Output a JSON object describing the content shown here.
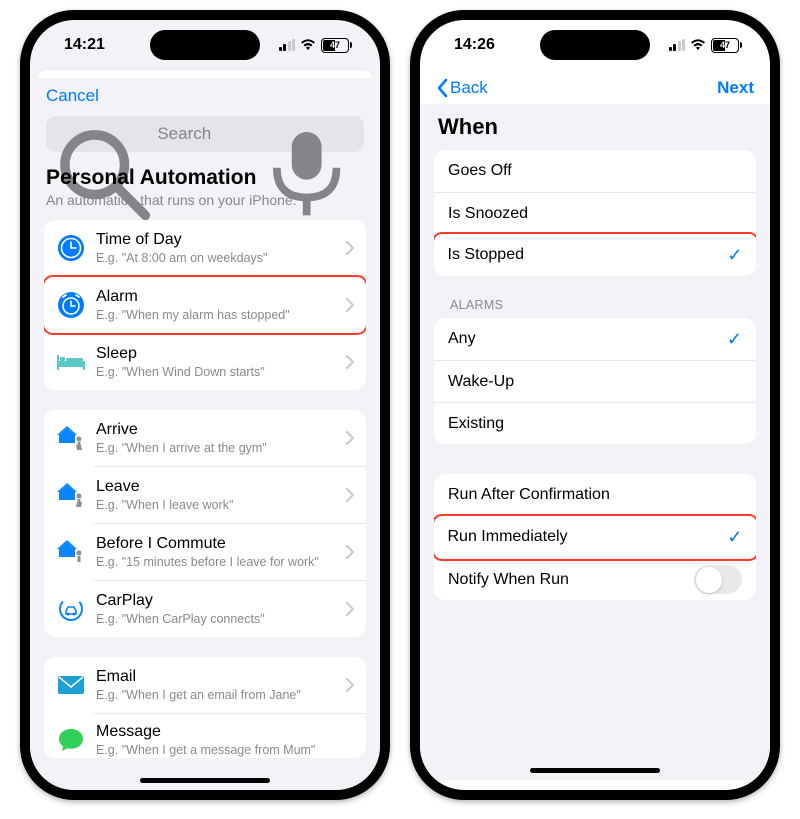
{
  "left": {
    "status": {
      "time": "14:21",
      "battery": "47"
    },
    "nav": {
      "cancel": "Cancel"
    },
    "search": {
      "placeholder": "Search"
    },
    "headline": {
      "title": "Personal Automation",
      "subtitle": "An automation that runs on your iPhone."
    },
    "groups": [
      {
        "rows": [
          {
            "icon": "clock-icon",
            "title": "Time of Day",
            "sub": "E.g. \"At 8:00 am on weekdays\"",
            "hl": false
          },
          {
            "icon": "alarm-icon",
            "title": "Alarm",
            "sub": "E.g. \"When my alarm has stopped\"",
            "hl": true
          },
          {
            "icon": "bed-icon",
            "title": "Sleep",
            "sub": "E.g. \"When Wind Down starts\"",
            "hl": false
          }
        ]
      },
      {
        "rows": [
          {
            "icon": "house-arrive-icon",
            "title": "Arrive",
            "sub": "E.g. \"When I arrive at the gym\"",
            "hl": false
          },
          {
            "icon": "house-leave-icon",
            "title": "Leave",
            "sub": "E.g. \"When I leave work\"",
            "hl": false
          },
          {
            "icon": "house-commute-icon",
            "title": "Before I Commute",
            "sub": "E.g. \"15 minutes before I leave for work\"",
            "hl": false
          },
          {
            "icon": "carplay-icon",
            "title": "CarPlay",
            "sub": "E.g. \"When CarPlay connects\"",
            "hl": false
          }
        ]
      },
      {
        "rows": [
          {
            "icon": "email-icon",
            "title": "Email",
            "sub": "E.g. \"When I get an email from Jane\"",
            "hl": false
          },
          {
            "icon": "message-icon",
            "title": "Message",
            "sub": "E.g. \"When I get a message from Mum\"",
            "hl": false
          }
        ]
      }
    ]
  },
  "right": {
    "status": {
      "time": "14:26",
      "battery": "47"
    },
    "nav": {
      "back": "Back",
      "next": "Next"
    },
    "title": "When",
    "when_group": [
      {
        "label": "Goes Off",
        "check": false,
        "hl": false
      },
      {
        "label": "Is Snoozed",
        "check": false,
        "hl": false
      },
      {
        "label": "Is Stopped",
        "check": true,
        "hl": true
      }
    ],
    "alarms_label": "ALARMS",
    "alarms_group": [
      {
        "label": "Any",
        "check": true
      },
      {
        "label": "Wake-Up",
        "check": false
      },
      {
        "label": "Existing",
        "check": false
      }
    ],
    "run_group": [
      {
        "label": "Run After Confirmation",
        "type": "plain"
      },
      {
        "label": "Run Immediately",
        "type": "check",
        "hl": true
      },
      {
        "label": "Notify When Run",
        "type": "toggle"
      }
    ]
  }
}
